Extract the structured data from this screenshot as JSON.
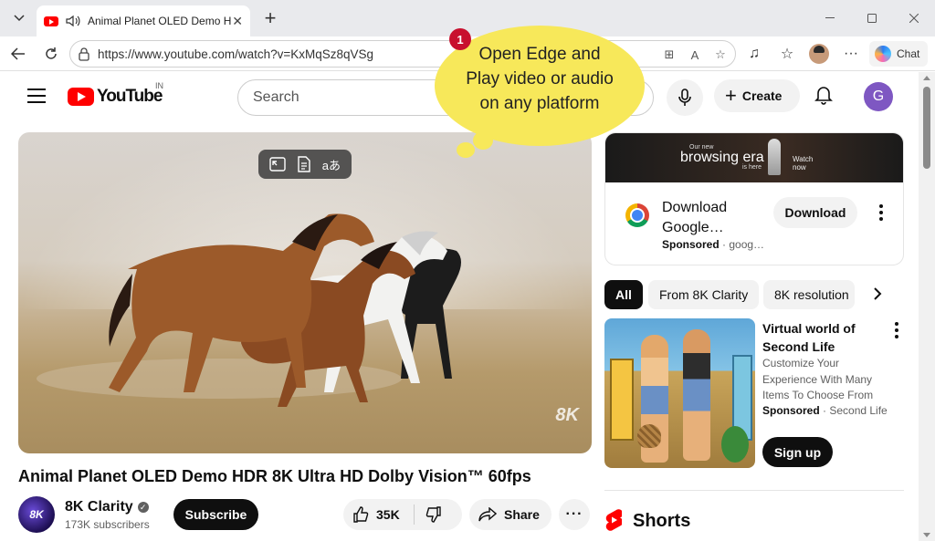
{
  "browser": {
    "tab_title": "Animal Planet OLED Demo HDR",
    "url": "https://www.youtube.com/watch?v=KxMqSz8qVSg",
    "chat_label": "Chat"
  },
  "youtube": {
    "logo_text": "YouTube",
    "region": "IN",
    "search_placeholder": "Search",
    "create_label": "Create",
    "user_initial": "G"
  },
  "callout": {
    "step": "1",
    "line1": "Open Edge and",
    "line2": "Play video or audio",
    "line3": "on any platform"
  },
  "video": {
    "watermark": "8K",
    "title": "Animal Planet OLED Demo HDR 8K Ultra HD Dolby Vision™ 60fps",
    "channel_name": "8K Clarity",
    "channel_avatar_text": "8K",
    "subscribers": "173K subscribers",
    "subscribe_label": "Subscribe",
    "likes": "35K",
    "share_label": "Share"
  },
  "ad": {
    "banner_small": "Our new",
    "banner_big": "browsing era",
    "banner_here": "is here",
    "banner_watch": "Watch",
    "banner_now": "now",
    "title": "Download Google…",
    "sponsored": "Sponsored",
    "domain": "goog…",
    "button": "Download"
  },
  "chips": [
    "All",
    "From 8K Clarity",
    "8K resolution"
  ],
  "promo": {
    "title": "Virtual world of Second Life",
    "description": "Customize Your Experience With Many Items To Choose From",
    "sponsored": "Sponsored",
    "advertiser": "Second Life",
    "button": "Sign up"
  },
  "shorts": {
    "label": "Shorts"
  },
  "colors": {
    "youtube_red": "#ff0000",
    "callout_yellow": "#f7e85a",
    "badge_red": "#c8102e"
  }
}
